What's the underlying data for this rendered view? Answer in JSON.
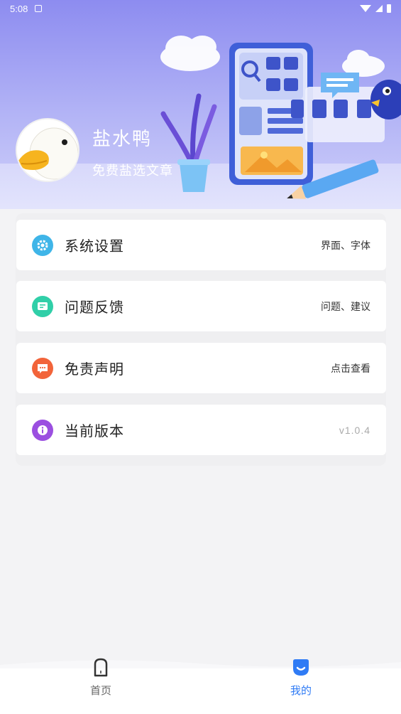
{
  "status_bar": {
    "time": "5:08"
  },
  "profile": {
    "name": "盐水鸭",
    "subtitle": "免费盐选文章"
  },
  "menu": [
    {
      "label": "系统设置",
      "value": "界面、字体",
      "icon": "gear-icon",
      "color": "#3fb5e8"
    },
    {
      "label": "问题反馈",
      "value": "问题、建议",
      "icon": "feedback-icon",
      "color": "#30cfa8"
    },
    {
      "label": "免责声明",
      "value": "点击查看",
      "icon": "chat-icon",
      "color": "#f2643a"
    },
    {
      "label": "当前版本",
      "value": "v1.0.4",
      "icon": "info-icon",
      "color": "#9b4fe0"
    }
  ],
  "nav": {
    "home": {
      "label": "首页",
      "icon": "home-icon"
    },
    "mine": {
      "label": "我的",
      "icon": "smile-icon",
      "active_color": "#2f7bf5"
    }
  }
}
